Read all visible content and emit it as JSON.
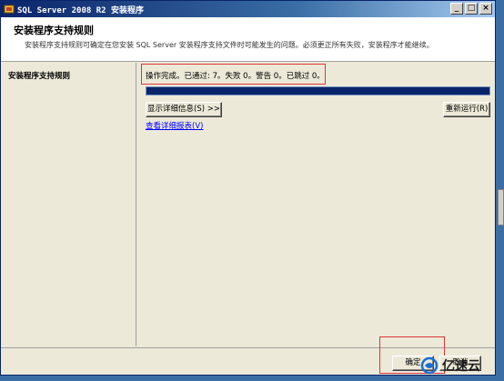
{
  "window": {
    "title": "SQL Server 2008 R2 安装程序",
    "buttons": {
      "minimize": "_",
      "maximize": "□",
      "close": "×"
    }
  },
  "header": {
    "title": "安装程序支持规则",
    "description": "安装程序支持规则可确定在您安装 SQL Server 安装程序支持文件时可能发生的问题。必须更正所有失败，安装程序才能继续。"
  },
  "sidebar": {
    "items": [
      {
        "label": "安装程序支持规则"
      }
    ]
  },
  "main": {
    "status": "操作完成。已通过: 7。失败 0。警告 0。已跳过 0。",
    "progress": 1.0,
    "show_details_label": "显示详细信息(S) >>",
    "rerun_label": "重新运行(R)",
    "report_link": "查看详细报表(V)"
  },
  "footer": {
    "ok_label": "确定",
    "cancel_label": "取消"
  },
  "watermark": {
    "text": "亿速云"
  },
  "colors": {
    "titlebar": "#0a246a",
    "progress": "#0a246a",
    "highlight_box": "#e0353a",
    "link": "#0000ff"
  }
}
